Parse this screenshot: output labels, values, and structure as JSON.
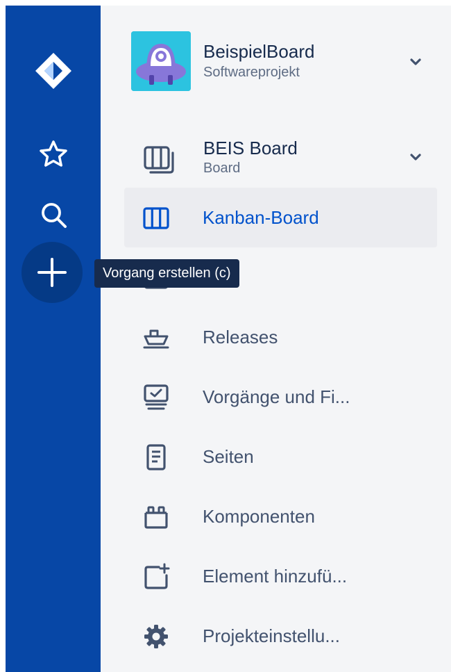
{
  "global_nav": {
    "logo_icon": "jira-logo-icon",
    "starred_icon": "star-icon",
    "search_icon": "search-icon",
    "create_icon": "plus-icon",
    "tooltip": "Vorgang erstellen (c)",
    "colors": {
      "background": "#0747a6",
      "create_button": "#053a86",
      "tooltip_bg": "#172b4d"
    }
  },
  "project": {
    "name": "BeispielBoard",
    "type": "Softwareprojekt",
    "avatar_icon": "robot-avatar-icon",
    "expand_icon": "chevron-down-icon"
  },
  "board": {
    "name": "BEIS Board",
    "type": "Board",
    "icon": "board-icon",
    "expand_icon": "chevron-down-icon"
  },
  "sidebar": {
    "items": [
      {
        "label": "Kanban-Board",
        "icon": "kanban-board-icon",
        "active": true
      },
      {
        "label": "",
        "icon": "backlog-icon",
        "active": false
      },
      {
        "label": "Releases",
        "icon": "ship-icon",
        "active": false
      },
      {
        "label": "Vorgänge und Fi...",
        "icon": "issues-filters-icon",
        "active": false
      },
      {
        "label": "Seiten",
        "icon": "page-icon",
        "active": false
      },
      {
        "label": "Komponenten",
        "icon": "component-icon",
        "active": false
      },
      {
        "label": "Element hinzufü...",
        "icon": "add-item-icon",
        "active": false
      },
      {
        "label": "Projekteinstellu...",
        "icon": "settings-icon",
        "active": false
      }
    ],
    "colors": {
      "background": "#f4f5f7",
      "active_bg": "#ebecf0",
      "active_text": "#0052cc",
      "text": "#42526e"
    }
  }
}
